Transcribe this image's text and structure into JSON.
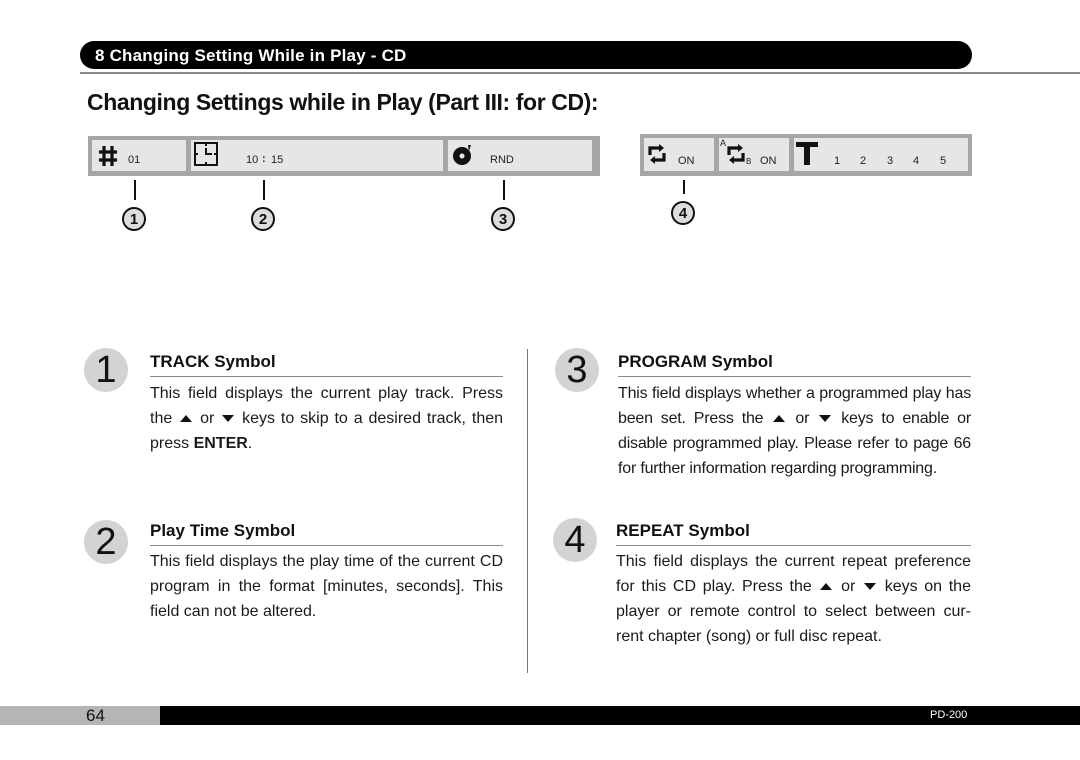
{
  "header": {
    "section_label": "8 Changing Setting While in Play - CD",
    "page_title": "Changing Settings while in Play (Part III: for CD):"
  },
  "display_left": {
    "track": {
      "icon": "hash-icon",
      "value": "01"
    },
    "time": {
      "icon": "clock-icon",
      "minutes": "10",
      "separator": ":",
      "seconds": "15"
    },
    "program": {
      "icon": "disc-icon",
      "value": "RND"
    }
  },
  "display_right": {
    "repeat": {
      "icon": "repeat-icon",
      "value": "ON"
    },
    "repeat_ab": {
      "icon": "repeat-ab-icon",
      "label_a": "A",
      "label_b": "B",
      "value": "ON"
    },
    "title_select": {
      "icon": "t-bar-icon",
      "numbers": [
        "1",
        "2",
        "3",
        "4",
        "5"
      ]
    }
  },
  "callouts": [
    "1",
    "2",
    "3",
    "4"
  ],
  "items": [
    {
      "number": "1",
      "title": "TRACK Symbol",
      "text_before": "This field displays the current play track. Press the",
      "text_or": "or",
      "text_after": "keys to skip to a desired track, then press",
      "text_bold": "ENTER",
      "text_end": "."
    },
    {
      "number": "2",
      "title": "Play Time Symbol",
      "text": "This field displays the play time of the current CD program in the format [minutes, seconds]. This field can not be altered."
    },
    {
      "number": "3",
      "title": "PROGRAM Symbol",
      "text_before": "This field displays whether a programmed play has been set. Press the",
      "text_or": "or",
      "text_after": "keys to enable or disable programmed play. Please refer to page 66 for further information regarding programming."
    },
    {
      "number": "4",
      "title": "REPEAT Symbol",
      "text_before": "This field displays the current repeat preference for this CD play. Press the",
      "text_or": "or",
      "text_after": "keys on the player or remote control to select between cur- rent chapter (song) or full disc repeat."
    }
  ],
  "footer": {
    "page_number": "64",
    "model": "PD-200"
  }
}
